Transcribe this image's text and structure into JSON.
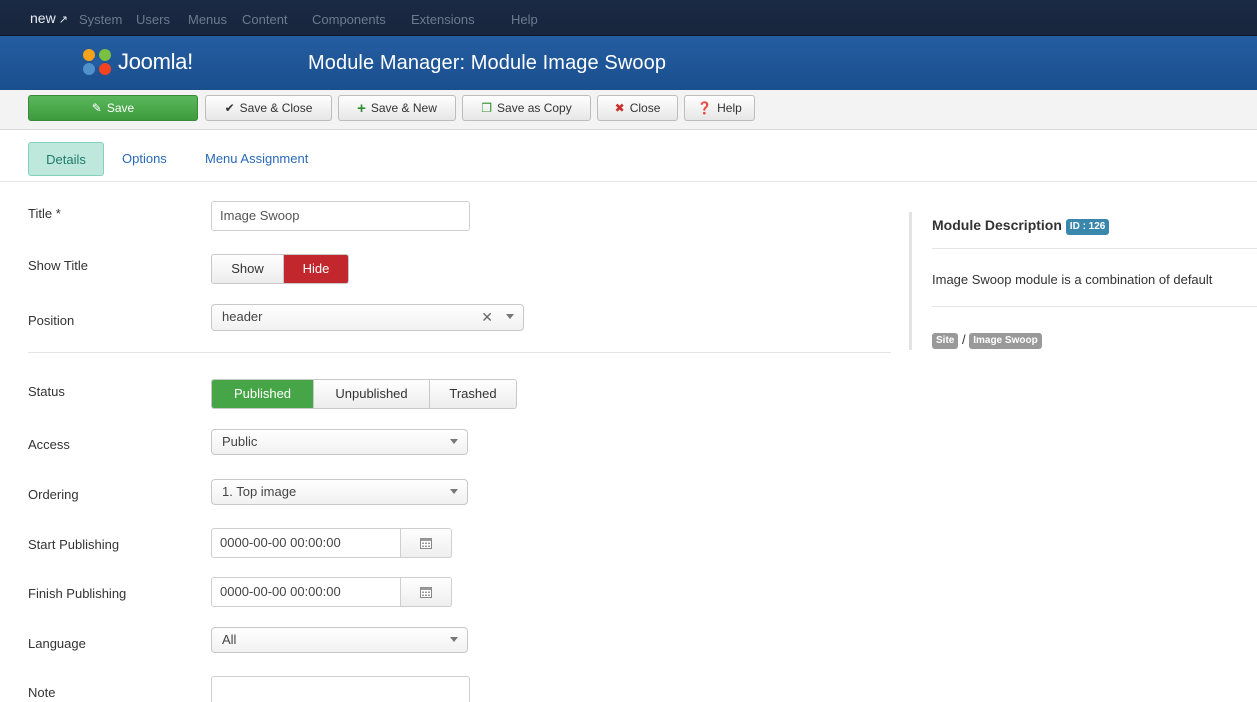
{
  "topbar": {
    "brand": "new",
    "menu": [
      "System",
      "Users",
      "Menus",
      "Content",
      "Components",
      "Extensions",
      "Help"
    ]
  },
  "header": {
    "logo_text": "Joomla!",
    "title": "Module Manager: Module Image Swoop"
  },
  "toolbar": {
    "save": "Save",
    "save_close": "Save & Close",
    "save_new": "Save & New",
    "save_copy": "Save as Copy",
    "close": "Close",
    "help": "Help"
  },
  "tabs": [
    "Details",
    "Options",
    "Menu Assignment"
  ],
  "form": {
    "title_label": "Title *",
    "title_value": "Image Swoop",
    "show_title_label": "Show Title",
    "show_title_options": [
      "Show",
      "Hide"
    ],
    "position_label": "Position",
    "position_value": "header",
    "status_label": "Status",
    "status_options": [
      "Published",
      "Unpublished",
      "Trashed"
    ],
    "access_label": "Access",
    "access_value": "Public",
    "ordering_label": "Ordering",
    "ordering_value": "1. Top image",
    "start_label": "Start Publishing",
    "start_value": "0000-00-00 00:00:00",
    "finish_label": "Finish Publishing",
    "finish_value": "0000-00-00 00:00:00",
    "language_label": "Language",
    "language_value": "All",
    "note_label": "Note",
    "note_value": ""
  },
  "sidebar": {
    "heading": "Module Description",
    "id_badge": "ID : 126",
    "description": "Image Swoop module is a combination of default",
    "crumb_site": "Site",
    "crumb_sep": "/",
    "crumb_module": "Image Swoop"
  },
  "colors": {
    "topbar": "#1b2a44",
    "header": "#245da1",
    "save_green": "#46a546",
    "hide_red": "#c1272d",
    "tab_active": "#bfe8dd",
    "badge_blue": "#3a87ad"
  }
}
